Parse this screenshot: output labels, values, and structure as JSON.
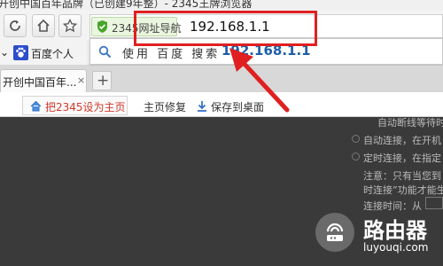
{
  "window": {
    "title": "开创中国百年品牌（已创建9年整）- 2345王牌浏览器"
  },
  "address_bar": {
    "site_badge": "2345网址导航",
    "url": "192.168.1.1"
  },
  "suggestion": {
    "prefix": "使用 百度 搜索",
    "query": "192.168.1.1"
  },
  "favorites": {
    "item_label": "百度个人"
  },
  "tabs": [
    {
      "label": "开创中国百年...",
      "close": "×"
    }
  ],
  "new_tab": "+",
  "link_bar": {
    "set_home": "把2345设为主页",
    "repair": "主页修复",
    "save_desktop": "保存到桌面"
  },
  "page": {
    "options": [
      "自动断线等待时间：",
      "自动连接，在开机",
      "定时连接，在指定",
      "注意：只有当您到",
      "时连接”功能才能生",
      "连接时间：从"
    ]
  },
  "watermark": {
    "name": "路由器",
    "site": "luyouqi.com"
  }
}
